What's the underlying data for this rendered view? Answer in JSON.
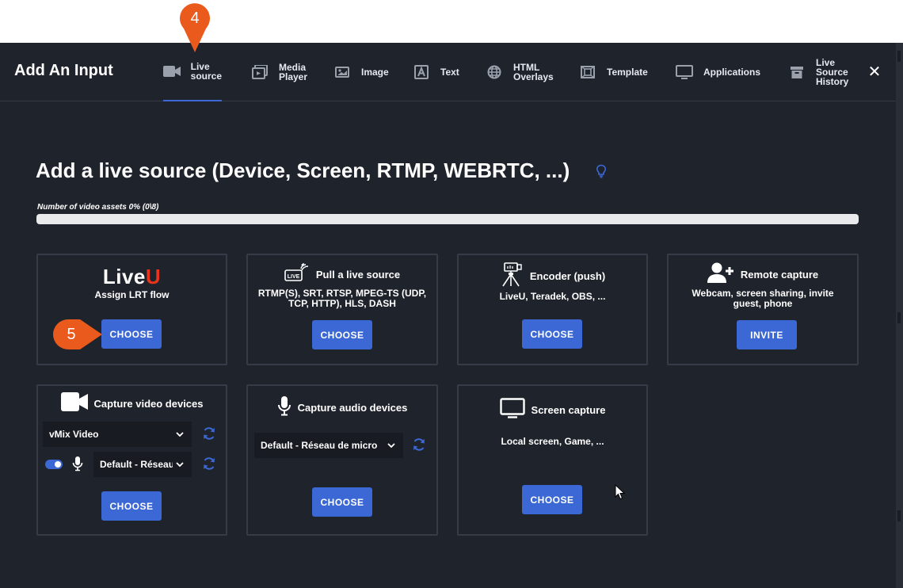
{
  "modal": {
    "title": "Add An Input",
    "tabs": [
      {
        "label": "Live\nsource",
        "icon": "video-camera-icon"
      },
      {
        "label": "Media\nPlayer",
        "icon": "media-player-icon"
      },
      {
        "label": "Image",
        "icon": "image-icon"
      },
      {
        "label": "Text",
        "icon": "text-icon"
      },
      {
        "label": "HTML\nOverlays",
        "icon": "globe-icon"
      },
      {
        "label": "Template",
        "icon": "template-icon"
      },
      {
        "label": "Applications",
        "icon": "monitor-icon"
      },
      {
        "label": "Live\nSource\nHistory",
        "icon": "archive-icon"
      }
    ],
    "active_tab": "Live source",
    "close_icon": "close-icon"
  },
  "heading": "Add a live source (Device, Screen, RTMP, WEBRTC, ...)",
  "progress": {
    "label": "Number of video assets 0% (0\\8)",
    "percent": 0
  },
  "cards": {
    "liveu": {
      "logo_a": "Live",
      "logo_b": "U",
      "subtitle": "Assign LRT flow",
      "button": "CHOOSE"
    },
    "pull": {
      "title": "Pull a live source",
      "subtitle": "RTMP(S), SRT, RTSP, MPEG-TS (UDP,\nTCP, HTTP), HLS, DASH",
      "button": "CHOOSE"
    },
    "encoder": {
      "title": "Encoder (push)",
      "subtitle": "LiveU, Teradek, OBS, ...",
      "button": "CHOOSE"
    },
    "remote": {
      "title": "Remote capture",
      "subtitle": "Webcam, screen sharing, invite\nguest, phone",
      "button": "INVITE"
    },
    "video": {
      "title": "Capture video devices",
      "video_select": "vMix Video",
      "audio_select": "Default - Réseau",
      "button": "CHOOSE"
    },
    "audio": {
      "title": "Capture audio devices",
      "audio_select": "Default - Réseau de micro",
      "button": "CHOOSE"
    },
    "screen": {
      "title": "Screen capture",
      "subtitle": "Local screen, Game, ...",
      "button": "CHOOSE"
    }
  },
  "annotations": {
    "step_4": "4",
    "step_5": "5"
  },
  "colors": {
    "background": "#1f232c",
    "accent": "#3b68d4",
    "card_border": "#363b47",
    "badge": "#ea5a1c",
    "liveu_red": "#e8341c"
  }
}
